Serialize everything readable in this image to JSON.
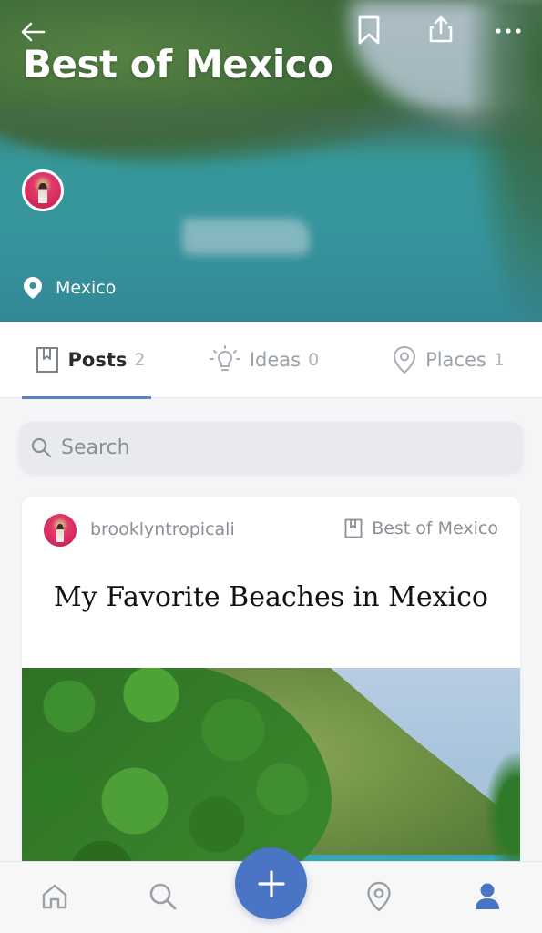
{
  "hero": {
    "title": "Best of Mexico",
    "location": "Mexico",
    "back_icon": "arrow-left-icon",
    "bookmark_icon": "bookmark-icon",
    "share_icon": "share-icon",
    "more_icon": "more-horizontal-icon"
  },
  "tabs": [
    {
      "label": "Posts",
      "count": "2",
      "icon": "bookmark-outline-icon",
      "active": true
    },
    {
      "label": "Ideas",
      "count": "0",
      "icon": "lightbulb-icon",
      "active": false
    },
    {
      "label": "Places",
      "count": "1",
      "icon": "map-pin-icon",
      "active": false
    }
  ],
  "search": {
    "placeholder": "Search"
  },
  "post": {
    "username": "brooklyntropicali",
    "collection": "Best of Mexico",
    "title": "My Favorite Beaches in Mexico"
  },
  "bottom_nav": {
    "items": [
      "home-icon",
      "search-icon",
      "add-icon",
      "map-pin-icon",
      "profile-icon"
    ]
  },
  "colors": {
    "accent": "#4a74c4",
    "tab_underline": "#5c83c4",
    "profile_active": "#4a74c4",
    "nav_inactive": "#9aa0a8"
  }
}
